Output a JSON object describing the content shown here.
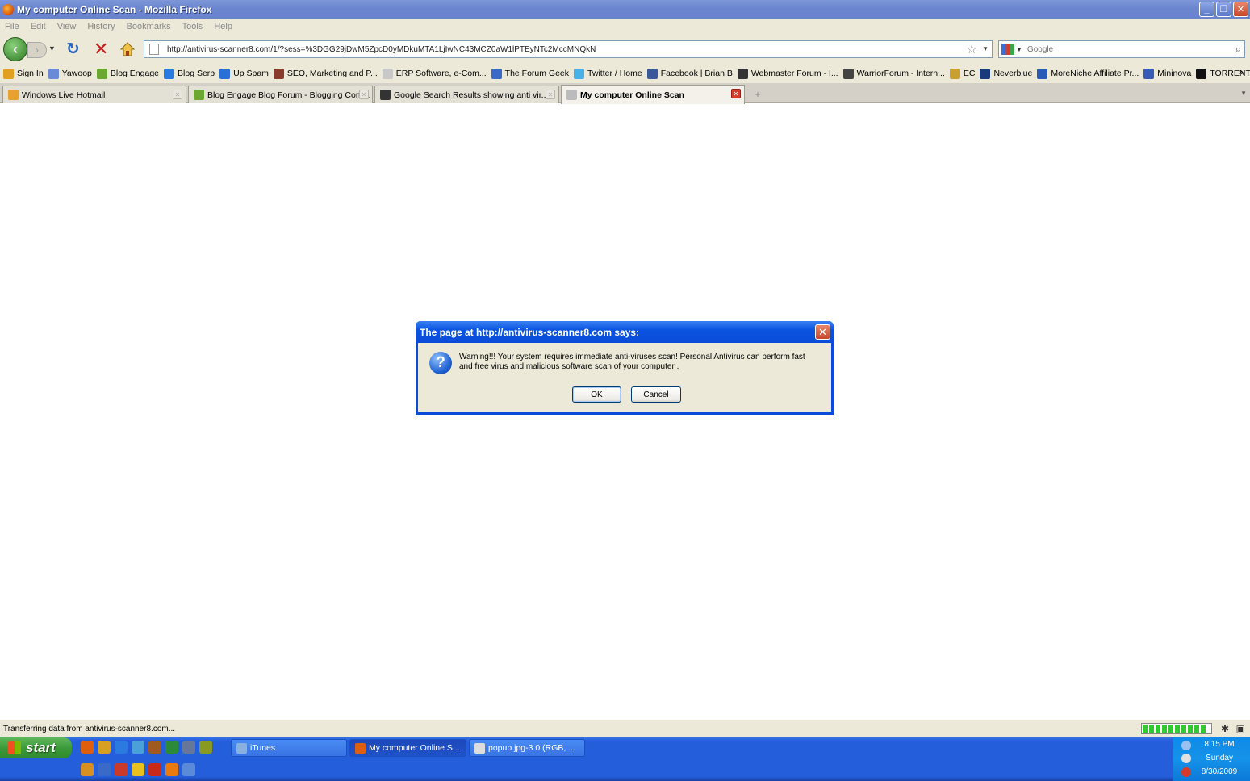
{
  "window": {
    "title": "My computer Online Scan - Mozilla Firefox",
    "controls": [
      "_",
      "❐",
      "✕"
    ]
  },
  "menu": [
    "File",
    "Edit",
    "View",
    "History",
    "Bookmarks",
    "Tools",
    "Help"
  ],
  "nav": {
    "url": "http://antivirus-scanner8.com/1/?sess=%3DGG29jDwM5ZpcD0yMDkuMTA1LjIwNC43MCZ0aW1lPTEyNTc2MccMNQkN",
    "search_placeholder": "Google"
  },
  "bookmarks": [
    {
      "label": "Sign In",
      "color": "#e0a020"
    },
    {
      "label": "Yawoop",
      "color": "#6a8ad8"
    },
    {
      "label": "Blog Engage",
      "color": "#6aa832"
    },
    {
      "label": "Blog Serp",
      "color": "#2a7ae0"
    },
    {
      "label": "Up Spam",
      "color": "#2a6fd8"
    },
    {
      "label": "SEO, Marketing and P...",
      "color": "#8a3a2a"
    },
    {
      "label": "ERP Software, e-Com...",
      "color": "#c8c8c8"
    },
    {
      "label": "The Forum Geek",
      "color": "#3a6ac8"
    },
    {
      "label": "Twitter / Home",
      "color": "#4ab0e8"
    },
    {
      "label": "Facebook | Brian B",
      "color": "#3b5998"
    },
    {
      "label": "Webmaster Forum - I...",
      "color": "#333333"
    },
    {
      "label": "WarriorForum - Intern...",
      "color": "#444444"
    },
    {
      "label": "EC",
      "color": "#c8a030"
    },
    {
      "label": "Neverblue",
      "color": "#1a3a7a"
    },
    {
      "label": "MoreNiche Affiliate Pr...",
      "color": "#2a5ab8"
    },
    {
      "label": "Mininova",
      "color": "#3a5ab8"
    },
    {
      "label": "TORRENTS",
      "color": "#111111"
    }
  ],
  "bookmarks_more": "»",
  "tabs": [
    {
      "label": "Windows Live Hotmail",
      "color": "#e8a030",
      "active": false
    },
    {
      "label": "Blog Engage Blog Forum - Blogging Com...",
      "color": "#6aa832",
      "active": false
    },
    {
      "label": "Google Search Results showing anti vir...",
      "color": "#333333",
      "active": false
    },
    {
      "label": "My computer Online Scan",
      "color": "#bbbbbb",
      "active": true
    }
  ],
  "new_tab": "+",
  "dialog": {
    "title": "The page at http://antivirus-scanner8.com says:",
    "icon": "question-icon",
    "message": "Warning!!! Your system requires immediate anti-viruses scan! Personal Antivirus can perform fast and free virus and malicious software scan of your computer .",
    "ok_label": "OK",
    "cancel_label": "Cancel"
  },
  "status": {
    "text": "Transferring data from antivirus-scanner8.com...",
    "progress": 0.95
  },
  "taskbar": {
    "start_label": "start",
    "quicklaunch_row1": [
      {
        "name": "firefox-icon",
        "color": "#e05f0e"
      },
      {
        "name": "chrome-icon",
        "color": "#d8a020"
      },
      {
        "name": "ie-icon",
        "color": "#2a7ae0"
      },
      {
        "name": "network-icon",
        "color": "#4aa0d8"
      },
      {
        "name": "winamp-icon",
        "color": "#a05a20"
      },
      {
        "name": "html-icon",
        "color": "#2a8a3a"
      },
      {
        "name": "eye-icon",
        "color": "#667799"
      },
      {
        "name": "dreamweaver-icon",
        "color": "#8a9a20"
      }
    ],
    "quicklaunch_row2": [
      {
        "name": "media-icon",
        "color": "#d89020"
      },
      {
        "name": "app-icon",
        "color": "#3a6ac8"
      },
      {
        "name": "shield-app-icon",
        "color": "#c83a2a"
      },
      {
        "name": "smiley-icon",
        "color": "#e8c020"
      },
      {
        "name": "filezilla-icon",
        "color": "#c82a1a"
      },
      {
        "name": "vlc-icon",
        "color": "#e87a10"
      },
      {
        "name": "tool-icon",
        "color": "#5a8ad8"
      }
    ],
    "tasks": [
      {
        "label": "iTunes",
        "color": "#8ab0e0",
        "active": false
      },
      {
        "label": "My computer Online S...",
        "color": "#e05f0e",
        "active": true
      },
      {
        "label": "popup.jpg-3.0 (RGB, ...",
        "color": "#dddddd",
        "active": false
      }
    ],
    "clock": {
      "time": "8:15 PM",
      "day": "Sunday",
      "date": "8/30/2009"
    }
  }
}
